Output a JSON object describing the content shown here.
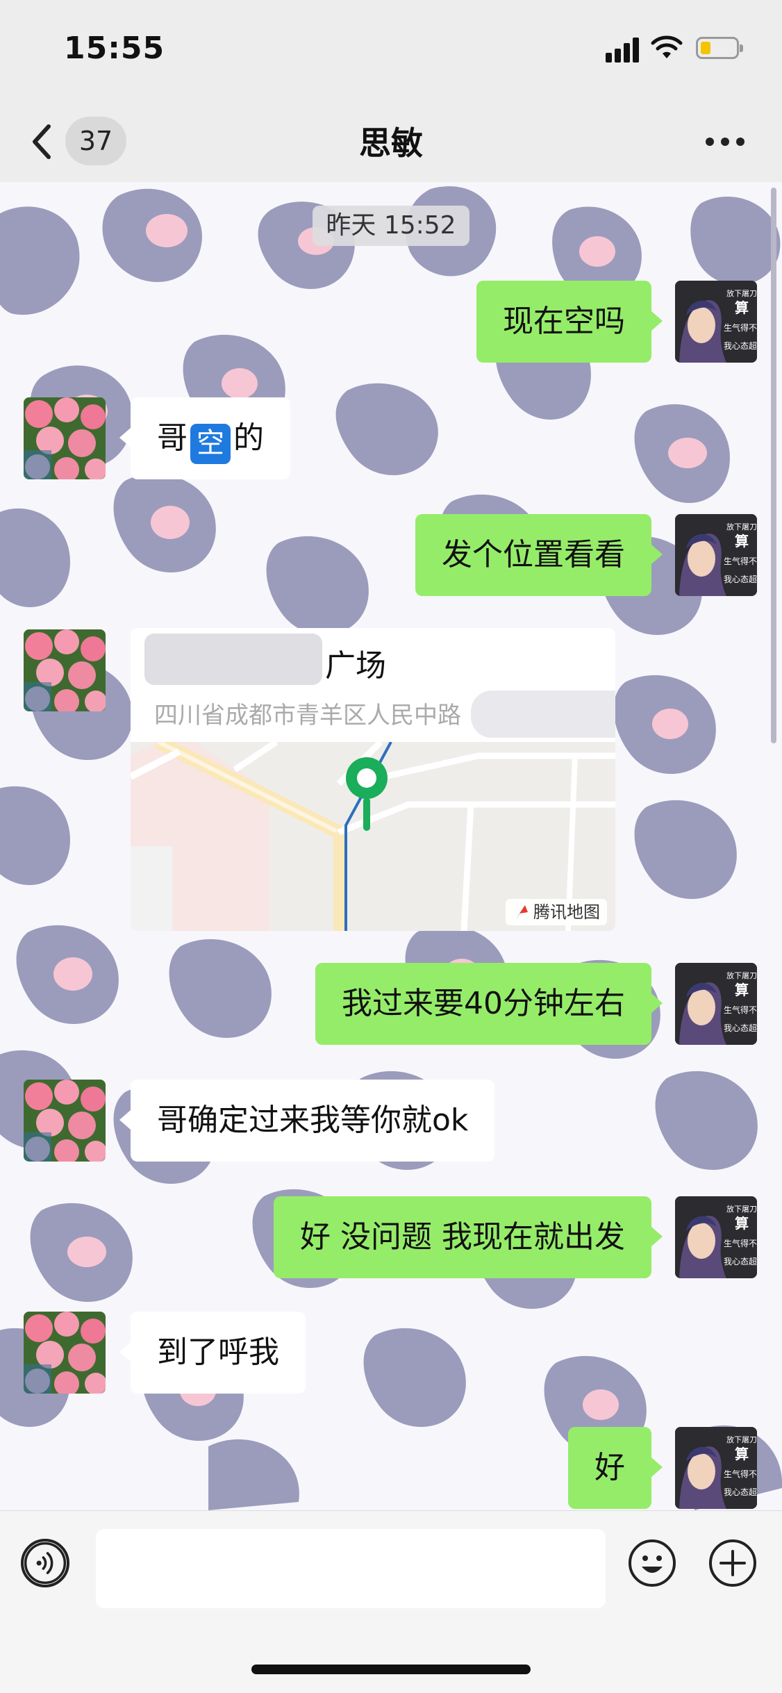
{
  "status_bar": {
    "time": "15:55"
  },
  "nav": {
    "unread_count": "37",
    "title": "思敏"
  },
  "chat": {
    "timestamp": "昨天 15:52",
    "messages": [
      {
        "side": "right",
        "text": "现在空吗"
      },
      {
        "side": "left",
        "text_before": "哥",
        "emoji_text": "空",
        "text_after": "的"
      },
      {
        "side": "right",
        "text": "发个位置看看"
      },
      {
        "side": "left",
        "type": "location",
        "name": "广场",
        "address": "四川省成都市青羊区人民中路",
        "map_watermark": "腾讯地图"
      },
      {
        "side": "right",
        "text": "我过来要40分钟左右"
      },
      {
        "side": "left",
        "text": "哥确定过来我等你就ok"
      },
      {
        "side": "right",
        "text": "好 没问题 我现在就出发"
      },
      {
        "side": "left",
        "text": "到了呼我"
      },
      {
        "side": "right",
        "text": "好"
      }
    ],
    "self_avatar_lines": [
      "放下屠刀",
      "算",
      "生气得不好",
      "我心态超棒"
    ]
  },
  "input": {
    "placeholder": ""
  },
  "colors": {
    "sent_bubble": "#95ec69",
    "received_bubble": "#ffffff",
    "leopard_spot": "#9b9cbc",
    "leopard_pink": "#f7c6d4"
  }
}
